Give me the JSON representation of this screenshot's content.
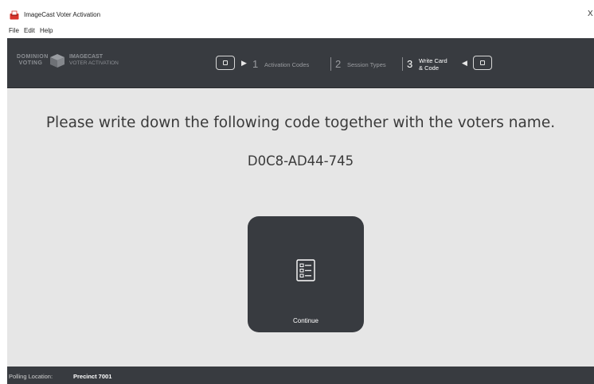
{
  "window": {
    "title": "ImageCast Voter Activation",
    "close_glyph": "X",
    "app_icon": "ballot-box-icon"
  },
  "menu": {
    "items": [
      "File",
      "Edit",
      "Help"
    ]
  },
  "header": {
    "brand": {
      "dominion_line1": "DOMINION",
      "dominion_line2": "VOTING",
      "product_line1": "IMAGECAST",
      "product_line2": "VOTER ACTIVATION"
    },
    "steps": [
      {
        "number": "1",
        "label": "Activation Codes",
        "active": false
      },
      {
        "number": "2",
        "label": "Session Types",
        "active": false
      },
      {
        "number": "3",
        "label_line1": "Write Card",
        "label_line2": "& Code",
        "active": true
      }
    ]
  },
  "main": {
    "instruction": "Please write down the following code together with the voters name.",
    "code": "D0C8-AD44-745",
    "continue_label": "Continue",
    "continue_icon": "checklist-icon"
  },
  "status": {
    "label": "Polling Location:",
    "value": "Precinct 7001"
  },
  "colors": {
    "header_bg": "#383b40",
    "content_bg": "#e6e6e6",
    "accent_red": "#d9342b"
  }
}
